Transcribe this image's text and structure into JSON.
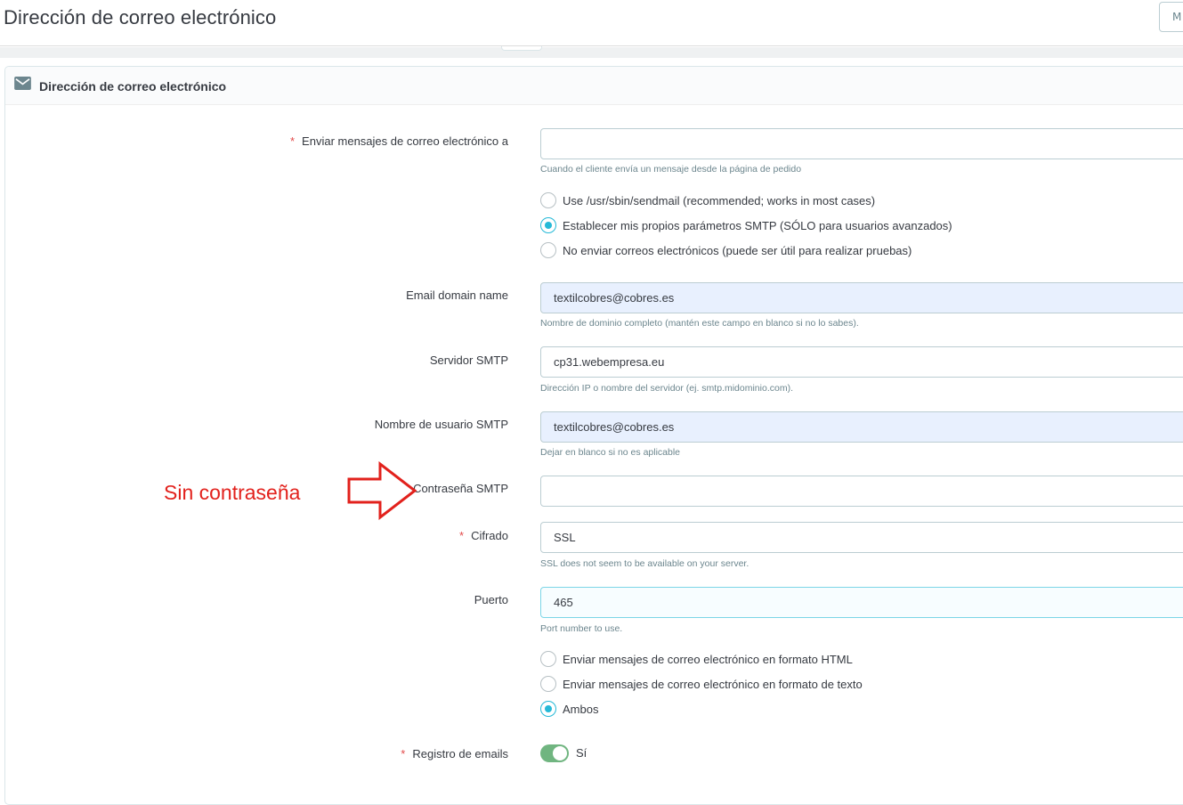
{
  "header": {
    "title": "Dirección de correo electrónico",
    "button_label": "M"
  },
  "panel": {
    "icon": "envelope-icon",
    "title": "Dirección de correo electrónico"
  },
  "form": {
    "send_to": {
      "label": "Enviar mensajes de correo electrónico a",
      "value": "",
      "help": "Cuando el cliente envía un mensaje desde la página de pedido"
    },
    "mail_method": {
      "options": [
        {
          "label": "Use /usr/sbin/sendmail (recommended; works in most cases)",
          "checked": false
        },
        {
          "label": "Establecer mis propios parámetros SMTP (SÓLO para usuarios avanzados)",
          "checked": true
        },
        {
          "label": "No enviar correos electrónicos (puede ser útil para realizar pruebas)",
          "checked": false
        }
      ]
    },
    "domain": {
      "label": "Email domain name",
      "value": "textilcobres@cobres.es",
      "help": "Nombre de dominio completo (mantén este campo en blanco si no lo sabes)."
    },
    "smtp_server": {
      "label": "Servidor SMTP",
      "value": "cp31.webempresa.eu",
      "help": "Dirección IP o nombre del servidor (ej. smtp.midominio.com)."
    },
    "smtp_user": {
      "label": "Nombre de usuario SMTP",
      "value": "textilcobres@cobres.es",
      "help": "Dejar en blanco si no es aplicable"
    },
    "smtp_password": {
      "label": "Contraseña SMTP",
      "value": ""
    },
    "encryption": {
      "label": "Cifrado",
      "value": "SSL",
      "help": "SSL does not seem to be available on your server."
    },
    "port": {
      "label": "Puerto",
      "value": "465",
      "help": "Port number to use."
    },
    "format": {
      "options": [
        {
          "label": "Enviar mensajes de correo electrónico en formato HTML",
          "checked": false
        },
        {
          "label": "Enviar mensajes de correo electrónico en formato de texto",
          "checked": false
        },
        {
          "label": "Ambos",
          "checked": true
        }
      ]
    },
    "email_log": {
      "label": "Registro de emails",
      "state_label": "Sí",
      "enabled": true
    }
  },
  "annotation": {
    "text": "Sin contraseña",
    "color": "#e2211c"
  },
  "colors": {
    "accent": "#25b9d7",
    "required": "#e24a4a",
    "switch_on": "#70b580",
    "autofill_bg": "#e8f0fe"
  }
}
